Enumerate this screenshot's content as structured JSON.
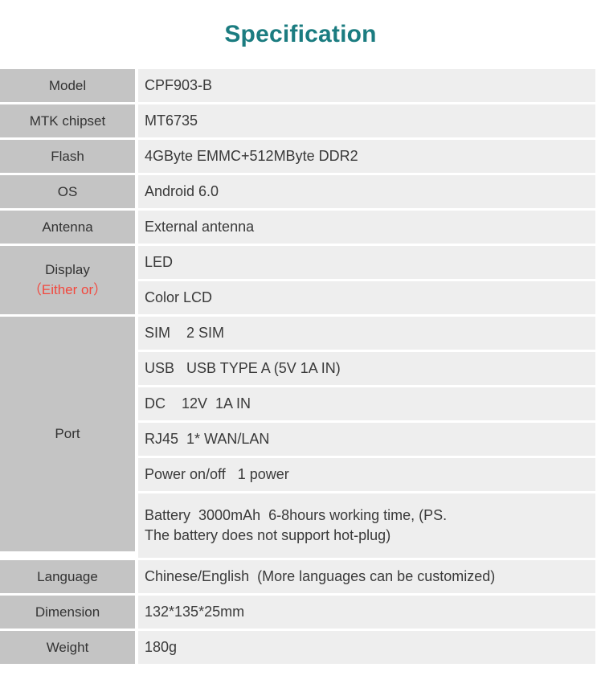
{
  "page": {
    "title": "Specification",
    "title_color": "#1b7c80",
    "label_bg": "#c4c4c4",
    "value_bg": "#eeeeee",
    "accent_red": "#f2483e"
  },
  "spec": {
    "rows": [
      {
        "label": "Model",
        "values": [
          "CPF903-B"
        ]
      },
      {
        "label": "MTK chipset",
        "values": [
          "MT6735"
        ]
      },
      {
        "label": "Flash",
        "values": [
          "4GByte EMMC+512MByte DDR2"
        ]
      },
      {
        "label": "OS",
        "values": [
          "Android 6.0"
        ]
      },
      {
        "label": "Antenna",
        "values": [
          "External antenna"
        ]
      },
      {
        "label": "Display",
        "label_sub": "（Either or）",
        "values": [
          "LED",
          "Color LCD"
        ]
      },
      {
        "label": "Port",
        "values": [
          "SIM    2 SIM",
          "USB   USB TYPE A (5V 1A IN)",
          "DC    12V  1A IN",
          "RJ45  1* WAN/LAN",
          "Power on/off   1 power"
        ],
        "values_multiline": [
          "Battery  3000mAh  6-8hours working time, (PS.",
          "The battery does not support hot-plug)"
        ]
      },
      {
        "label": "Language",
        "values": [
          "Chinese/English  (More languages can be customized)"
        ]
      },
      {
        "label": "Dimension",
        "values": [
          "132*135*25mm"
        ]
      },
      {
        "label": "Weight",
        "values": [
          "180g"
        ]
      }
    ]
  }
}
